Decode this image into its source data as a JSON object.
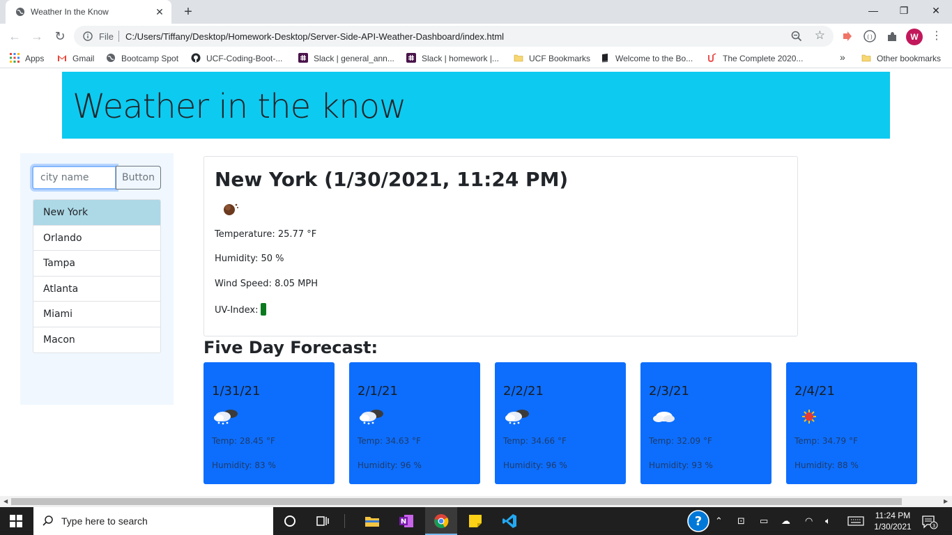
{
  "browser": {
    "tab_title": "Weather In the Know",
    "tab_close": "✕",
    "new_tab": "+",
    "window_buttons": {
      "minimize": "—",
      "restore": "❐",
      "close": "✕"
    },
    "omnibox_scheme": "File",
    "url": "C:/Users/Tiffany/Desktop/Homework-Desktop/Server-Side-API-Weather-Dashboard/index.html",
    "profile_letter": "W",
    "bookmarks": [
      "Apps",
      "Gmail",
      "Bootcamp Spot",
      "UCF-Coding-Boot-...",
      "Slack | general_ann...",
      "Slack | homework |...",
      "UCF Bookmarks",
      "Welcome to the Bo...",
      "The Complete 2020..."
    ],
    "more_bookmarks": "»",
    "other_bookmarks": "Other bookmarks"
  },
  "header": {
    "title": "Weather in the know"
  },
  "sidebar": {
    "search_placeholder": "city name",
    "search_button": "Button",
    "cities": [
      "New York",
      "Orlando",
      "Tampa",
      "Atlanta",
      "Miami",
      "Macon"
    ],
    "active_city": "New York"
  },
  "current": {
    "title": "New York (1/30/2021, 11:24 PM)",
    "icon": "night-cloud-icon",
    "temperature": "Temperature: 25.77 °F",
    "humidity": "Humidity: 50 %",
    "wind": "Wind Speed: 8.05 MPH",
    "uv_label": "UV-Index:",
    "uv_color": "#0b7a1f"
  },
  "forecast": {
    "title": "Five Day Forecast:",
    "card_color": "#0d6efd",
    "days": [
      {
        "date": "1/31/21",
        "icon": "snow-cloud-icon",
        "temp": "Temp: 28.45 °F",
        "humidity": "Humidity: 83 %"
      },
      {
        "date": "2/1/21",
        "icon": "snow-cloud-icon",
        "temp": "Temp: 34.63 °F",
        "humidity": "Humidity: 96 %"
      },
      {
        "date": "2/2/21",
        "icon": "snow-cloud-icon",
        "temp": "Temp: 34.66 °F",
        "humidity": "Humidity: 96 %"
      },
      {
        "date": "2/3/21",
        "icon": "cloud-icon",
        "temp": "Temp: 32.09 °F",
        "humidity": "Humidity: 93 %"
      },
      {
        "date": "2/4/21",
        "icon": "sun-icon",
        "temp": "Temp: 34.79 °F",
        "humidity": "Humidity: 88 %"
      }
    ]
  },
  "taskbar": {
    "search_placeholder": "Type here to search",
    "time": "11:24 PM",
    "date": "1/30/2021",
    "notification_count": "3"
  }
}
